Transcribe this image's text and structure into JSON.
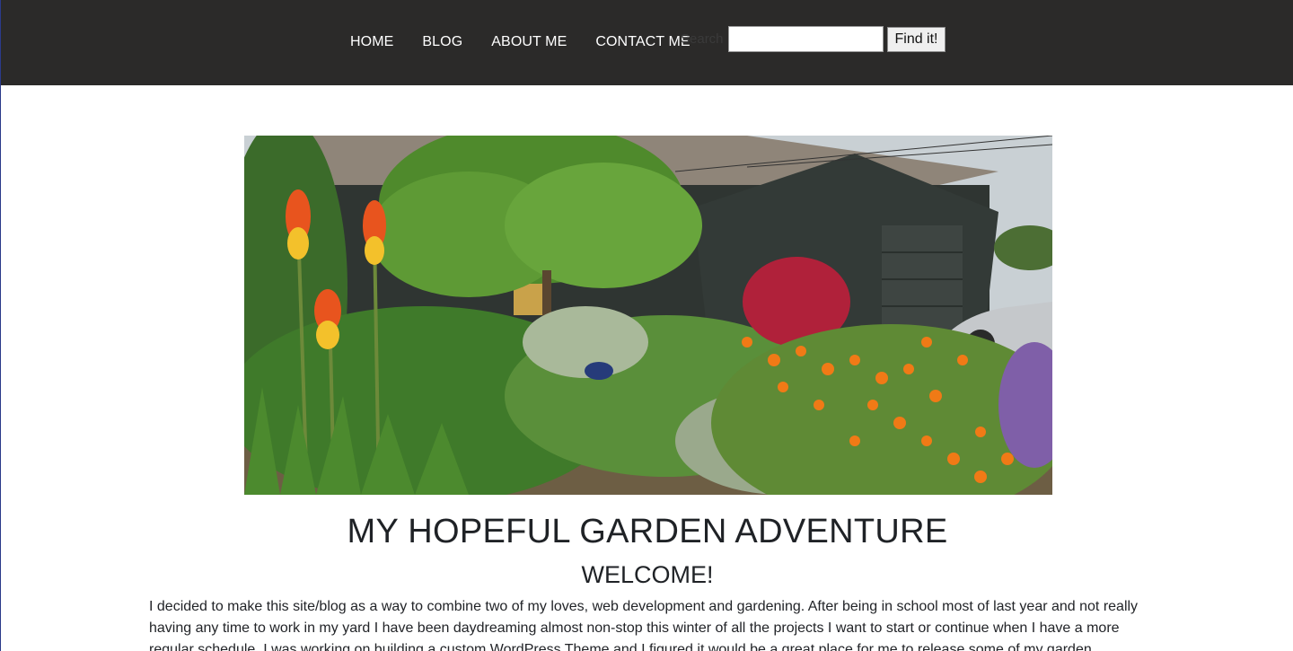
{
  "nav": {
    "items": [
      {
        "label": "HOME"
      },
      {
        "label": "BLOG"
      },
      {
        "label": "ABOUT ME"
      },
      {
        "label": "CONTACT ME"
      }
    ]
  },
  "search": {
    "label": "Search",
    "value": "",
    "button_label": "Find it!"
  },
  "hero": {
    "image_name": "garden-photo"
  },
  "content": {
    "title": "MY HOPEFUL GARDEN ADVENTURE",
    "subtitle": "WELCOME!",
    "intro": "I decided to make this site/blog as a way to combine two of my loves, web development and gardening. After being in school most of last year and not really having any time to work in my yard I have been daydreaming almost non-stop this winter of all the projects I want to start or continue when I have a more regular schedule. I was working on building a custom WordPress Theme and I figured it would be a great place for me to release some of my garden"
  },
  "colors": {
    "header_bg": "#2b2a29",
    "nav_text": "#ffffff",
    "body_text": "#1f2226"
  }
}
